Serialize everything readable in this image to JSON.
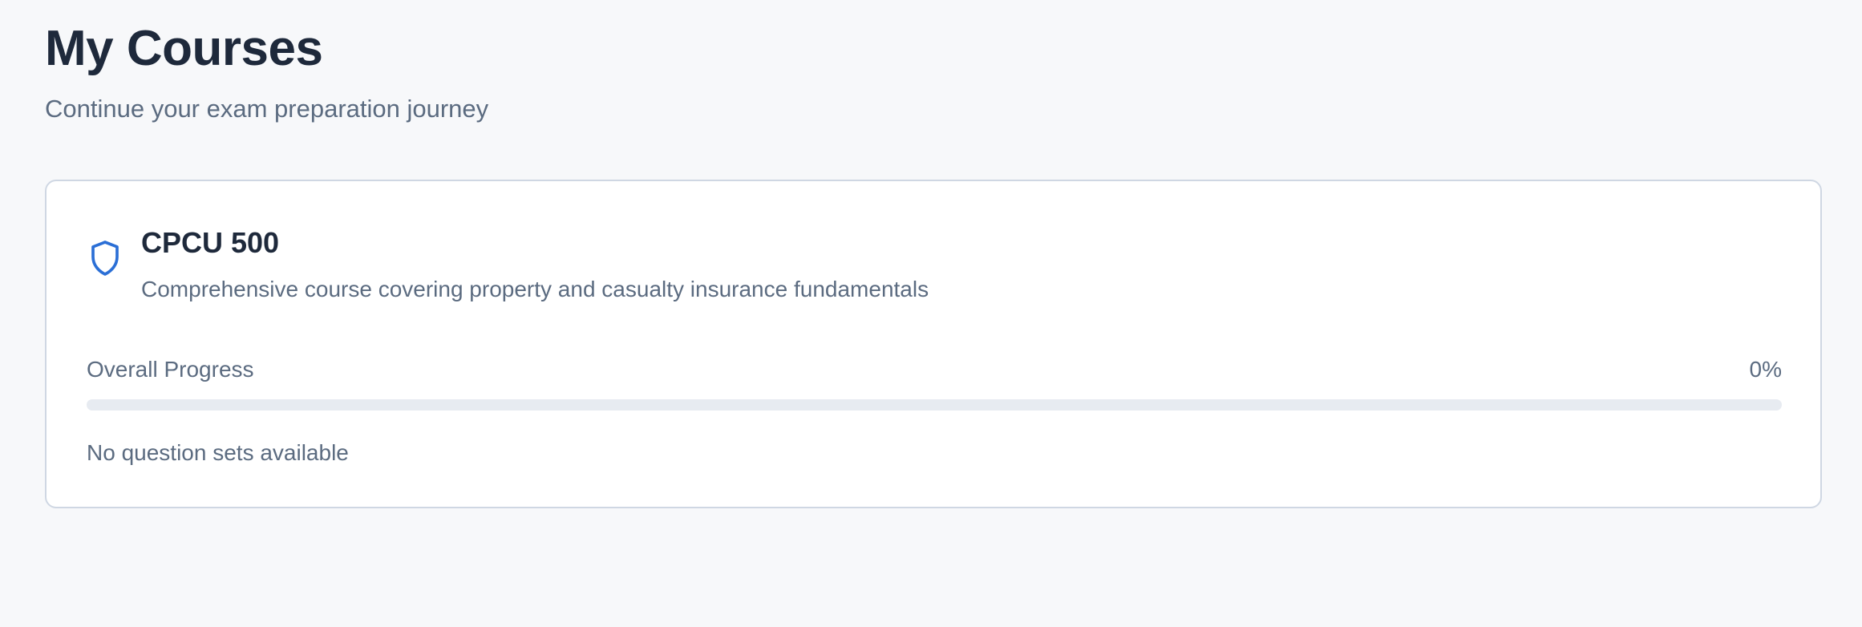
{
  "header": {
    "title": "My Courses",
    "subtitle": "Continue your exam preparation journey"
  },
  "course": {
    "icon": "shield-icon",
    "name": "CPCU 500",
    "description": "Comprehensive course covering property and casualty insurance fundamentals",
    "progress": {
      "label": "Overall Progress",
      "value_text": "0%",
      "value": 0
    },
    "empty_message": "No question sets available"
  },
  "colors": {
    "accent": "#2b6fd6",
    "background": "#f7f8fa",
    "card_border": "#cfd7e3",
    "progress_track": "#e7ebf1"
  }
}
